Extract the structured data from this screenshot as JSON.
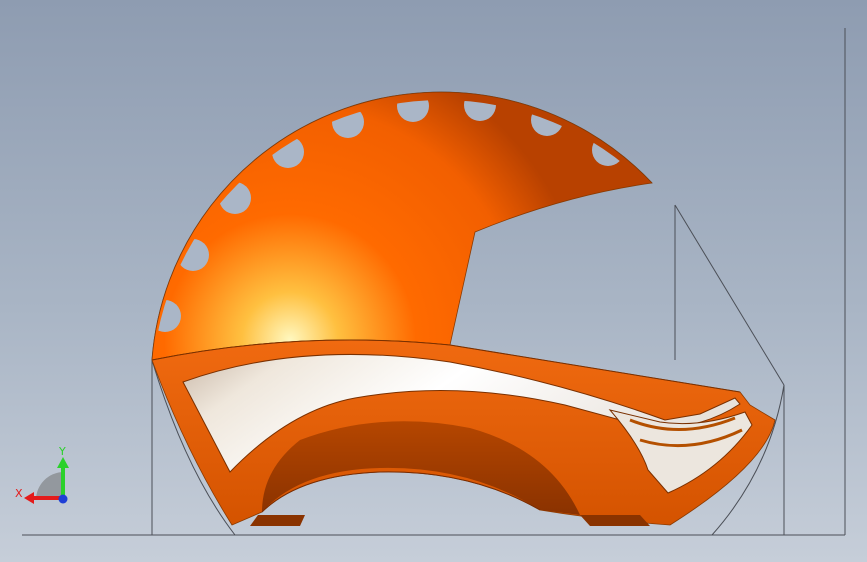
{
  "viewport": {
    "background_top": "#8e9cb1",
    "background_bottom": "#c6ced9",
    "model_color": "#ff6a00",
    "model_shadow_color": "#a83d00",
    "visor_color": "#f2eee8"
  },
  "triad": {
    "x_label": "X",
    "y_label": "Y",
    "x_color": "#e41b1b",
    "y_color": "#2bd12b",
    "z_color": "#1f3fd6",
    "x_icon": "x-axis-arrow-icon",
    "y_icon": "y-axis-arrow-icon",
    "z_icon": "z-axis-dot-icon"
  }
}
